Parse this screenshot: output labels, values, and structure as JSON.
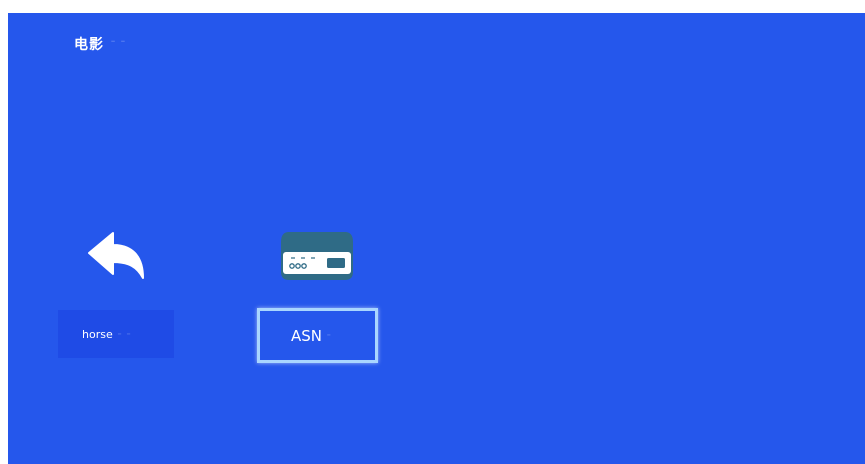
{
  "header": {
    "title": "电影"
  },
  "items": [
    {
      "label": "horse",
      "icon": "back-arrow-icon"
    },
    {
      "label": "ASN",
      "icon": "storage-device-icon"
    }
  ],
  "colors": {
    "background": "#2557ec",
    "focus_border": "#a9d6ff"
  }
}
